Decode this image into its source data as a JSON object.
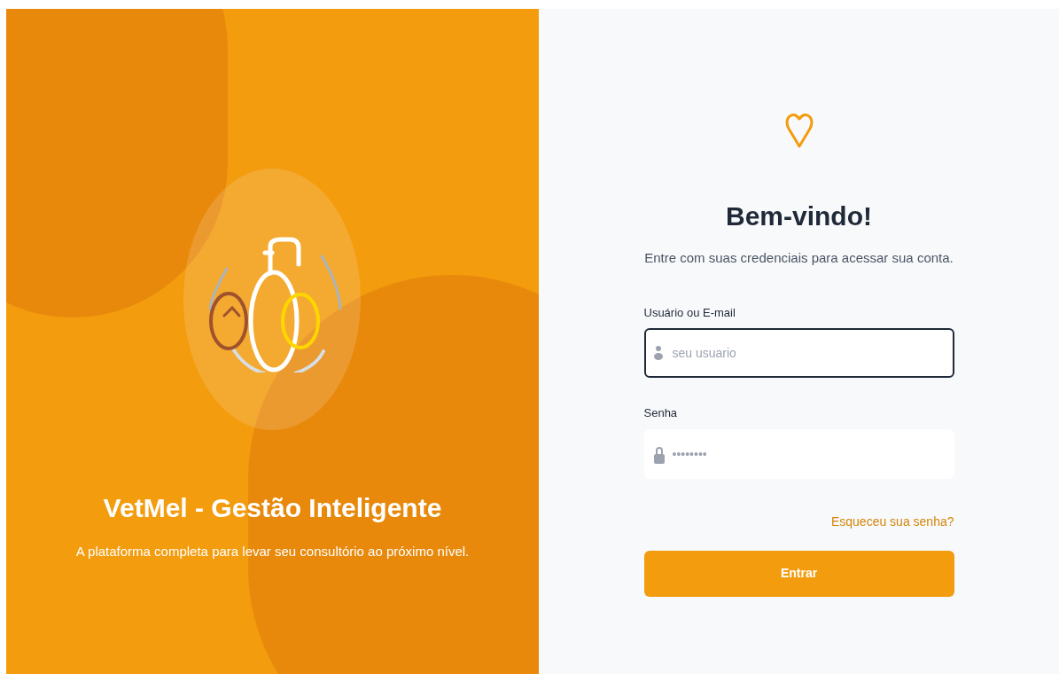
{
  "hero": {
    "title": "VetMel - Gestão Inteligente",
    "subtitle": "A plataforma completa para levar seu consultório ao próximo nível."
  },
  "login": {
    "heading": "Bem-vindo!",
    "intro": "Entre com suas credenciais para acessar sua conta.",
    "fields": [
      {
        "label": "Usuário ou E-mail",
        "placeholder": "seu usuario",
        "kind": "user",
        "focused": true
      },
      {
        "label": "Senha",
        "placeholder": "••••••••",
        "kind": "password",
        "focused": false
      }
    ],
    "forgot_link": "Esqueceu sua senha?",
    "submit": "Entrar"
  }
}
